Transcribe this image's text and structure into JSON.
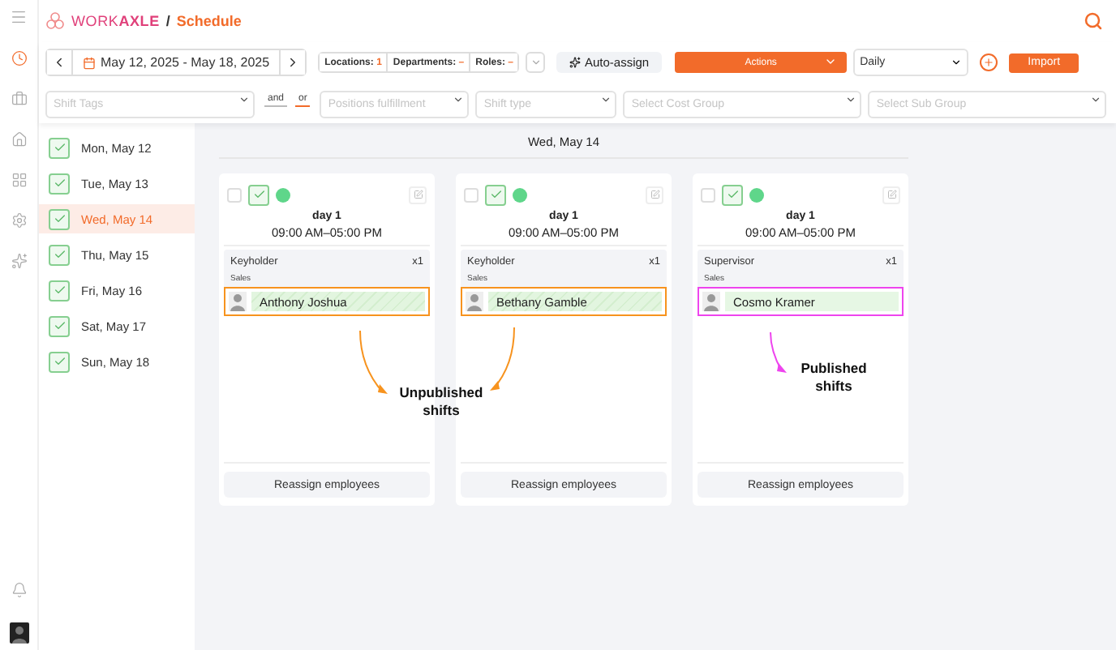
{
  "header": {
    "brand_light": "WORK",
    "brand_bold": "AXLE",
    "separator": "/",
    "page": "Schedule"
  },
  "toolbar": {
    "date_range": "May 12, 2025 - May 18, 2025",
    "filters": [
      {
        "label": "Locations:",
        "value": "1"
      },
      {
        "label": "Departments:",
        "value": "–"
      },
      {
        "label": "Roles:",
        "value": "–"
      }
    ],
    "auto_assign": "Auto-assign",
    "actions": "Actions",
    "view": "Daily",
    "import": "Import",
    "selects": [
      {
        "placeholder": "Shift Tags"
      },
      {
        "placeholder": "Positions fulfillment"
      },
      {
        "placeholder": "Shift type"
      },
      {
        "placeholder": "Select Cost Group"
      },
      {
        "placeholder": "Select Sub Group"
      }
    ],
    "logic": [
      {
        "label": "and",
        "selected": false
      },
      {
        "label": "or",
        "selected": true
      }
    ]
  },
  "days": [
    {
      "label": "Mon, May 12",
      "checked": true,
      "selected": false
    },
    {
      "label": "Tue, May 13",
      "checked": true,
      "selected": false
    },
    {
      "label": "Wed, May 14",
      "checked": true,
      "selected": true
    },
    {
      "label": "Thu, May 15",
      "checked": true,
      "selected": false
    },
    {
      "label": "Fri, May 16",
      "checked": true,
      "selected": false
    },
    {
      "label": "Sat, May 17",
      "checked": true,
      "selected": false
    },
    {
      "label": "Sun, May 18",
      "checked": true,
      "selected": false
    }
  ],
  "column": {
    "title": "Wed, May 14"
  },
  "shifts": [
    {
      "selected": false,
      "approved": true,
      "title": "day 1",
      "time": "09:00 AM–05:00 PM",
      "role": "Keyholder",
      "count": "x1",
      "department": "Sales",
      "employee": "Anthony Joshua",
      "published": false,
      "action": "Reassign employees"
    },
    {
      "selected": false,
      "approved": true,
      "title": "day 1",
      "time": "09:00 AM–05:00 PM",
      "role": "Keyholder",
      "count": "x1",
      "department": "Sales",
      "employee": "Bethany Gamble",
      "published": false,
      "action": "Reassign employees"
    },
    {
      "selected": false,
      "approved": true,
      "title": "day 1",
      "time": "09:00 AM–05:00 PM",
      "role": "Supervisor",
      "count": "x1",
      "department": "Sales",
      "employee": "Cosmo Kramer",
      "published": true,
      "action": "Reassign employees"
    }
  ],
  "annotations": [
    {
      "kind": "unpublished",
      "text": "Unpublished shifts"
    },
    {
      "kind": "published",
      "text": "Published shifts"
    }
  ]
}
